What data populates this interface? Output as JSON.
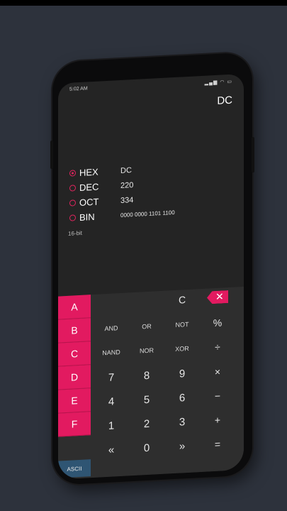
{
  "status_bar": {
    "time": "5:02 AM",
    "icons": [
      "signal-icon",
      "wifi-icon",
      "battery-icon"
    ]
  },
  "display": {
    "value": "DC"
  },
  "bases": [
    {
      "label": "HEX",
      "value": "DC",
      "selected": true
    },
    {
      "label": "DEC",
      "value": "220",
      "selected": false
    },
    {
      "label": "OCT",
      "value": "334",
      "selected": false
    },
    {
      "label": "BIN",
      "value": "0000 0000 1101 1100",
      "selected": false
    }
  ],
  "word_size": "16-bit",
  "keypad": {
    "hex_keys": [
      "A",
      "B",
      "C",
      "D",
      "E",
      "F"
    ],
    "ascii_label": "ASCII",
    "clear_label": "C",
    "logic_row1": [
      "AND",
      "OR",
      "NOT"
    ],
    "logic_row2": [
      "NAND",
      "NOR",
      "XOR"
    ],
    "digits_row1": [
      "7",
      "8",
      "9"
    ],
    "digits_row2": [
      "4",
      "5",
      "6"
    ],
    "digits_row3": [
      "1",
      "2",
      "3"
    ],
    "bottom_row": [
      "«",
      "0",
      "»"
    ],
    "ops": [
      "%",
      "÷",
      "×",
      "−",
      "+",
      "="
    ],
    "backspace_icon": "backspace-icon"
  },
  "colors": {
    "accent": "#e21a60",
    "ascii": "#2f5573",
    "background": "#2d323c"
  }
}
